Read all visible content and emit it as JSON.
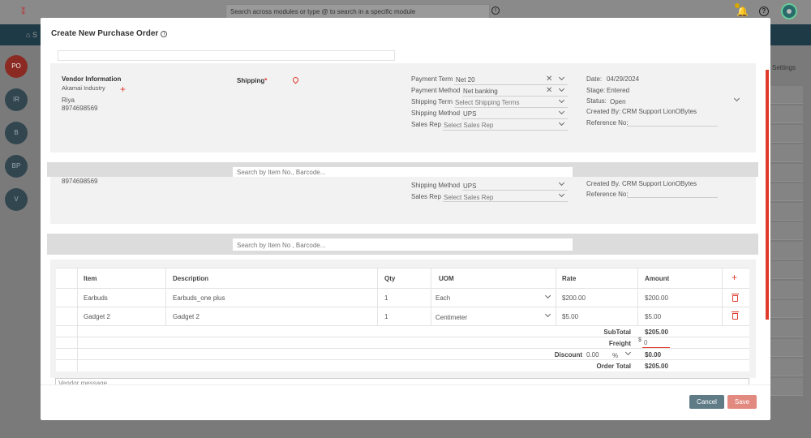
{
  "app": {
    "search_placeholder": "Search across modules or type @ to search in a specific module",
    "settings_label": "Settings",
    "nav_home_label": "S",
    "side_badges": [
      "PO",
      "IR",
      "B",
      "BP",
      "V"
    ]
  },
  "modal": {
    "title": "Create New Purchase Order",
    "vendor": {
      "heading": "Vendor Information",
      "name": "Akamai Industry",
      "contact": "Riya",
      "phone": "8974698569",
      "phone_repeat": "8974698569"
    },
    "shipping": {
      "label": "Shipping",
      "required_mark": "*"
    },
    "terms": {
      "payment_term_label": "Payment Term",
      "payment_term_value": "Net 20",
      "payment_method_label": "Payment Method",
      "payment_method_value": "Net banking",
      "shipping_term_label": "Shipping Term",
      "shipping_term_placeholder": "Select Shipping Terms",
      "shipping_method_label": "Shipping Method",
      "shipping_method_value": "UPS",
      "sales_rep_label": "Sales Rep",
      "sales_rep_placeholder": "Select Sales Rep"
    },
    "meta": {
      "date_label": "Date:",
      "date_value": "04/29/2024",
      "stage_label": "Stage:",
      "stage_value": "Entered",
      "status_label": "Status:",
      "status_value": "Open",
      "created_by_label": "Created By:",
      "created_by_value": "CRM Support LionOBytes",
      "created_by_label_2": "Created By.",
      "reference_label": "Reference No:"
    },
    "item_search_placeholder": "Search by Item No., Barcode...",
    "item_search_placeholder_2": "Search by Item No , Barcode...",
    "table": {
      "headers": [
        "Item",
        "Description",
        "Qty",
        "UOM",
        "Rate",
        "Amount"
      ],
      "rows": [
        {
          "item": "Earbuds",
          "description": "Earbuds_one plus",
          "qty": "1",
          "uom": "Each",
          "rate": "$200.00",
          "amount": "$200.00"
        },
        {
          "item": "Gadget 2",
          "description": "Gadget 2",
          "qty": "1",
          "uom": "Centimeter",
          "rate": "$5.00",
          "amount": "$5.00"
        }
      ]
    },
    "totals": {
      "subtotal_label": "SubTotal",
      "subtotal_value": "$205.00",
      "freight_label": "Freight",
      "freight_currency": "$",
      "freight_value": "0",
      "discount_label": "Discount",
      "discount_value": "0.00",
      "discount_unit": "%",
      "discount_amount": "$0.00",
      "order_total_label": "Order Total",
      "order_total_value": "$205.00"
    },
    "vendor_message_placeholder": "Vendor message",
    "buttons": {
      "cancel": "Cancel",
      "save": "Save"
    }
  },
  "colors": {
    "accent": "#e03a2a",
    "cancel_button": "#5f7b86",
    "save_button": "#e28a80",
    "nav_bar": "#1d3a46"
  }
}
